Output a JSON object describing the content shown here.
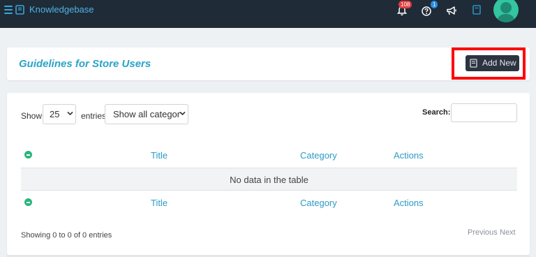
{
  "topbar": {
    "brand": "Knowledgebase",
    "notifications_count": "108",
    "help_count": "1",
    "icons": [
      "menu-icon",
      "book-icon",
      "bell-icon",
      "help-icon",
      "megaphone-icon",
      "notebook-icon",
      "avatar"
    ]
  },
  "page": {
    "title": "Guidelines for Store Users",
    "add_button_label": "Add New"
  },
  "table_controls": {
    "show_label": "Show",
    "page_size": "25",
    "entries_label": "entries",
    "category_filter": "Show all categor",
    "search_label": "Search:"
  },
  "table": {
    "columns": [
      "Title",
      "Category",
      "Actions"
    ],
    "empty_message": "No data in the table",
    "info": "Showing 0 to 0 of 0 entries",
    "prev_label": "Previous",
    "next_label": "Next"
  },
  "colors": {
    "topbar": "#1f2b37",
    "accent": "#2aa3c8",
    "button": "#2b3440",
    "highlight": "#ff0000",
    "toggle": "#2ab57d"
  }
}
